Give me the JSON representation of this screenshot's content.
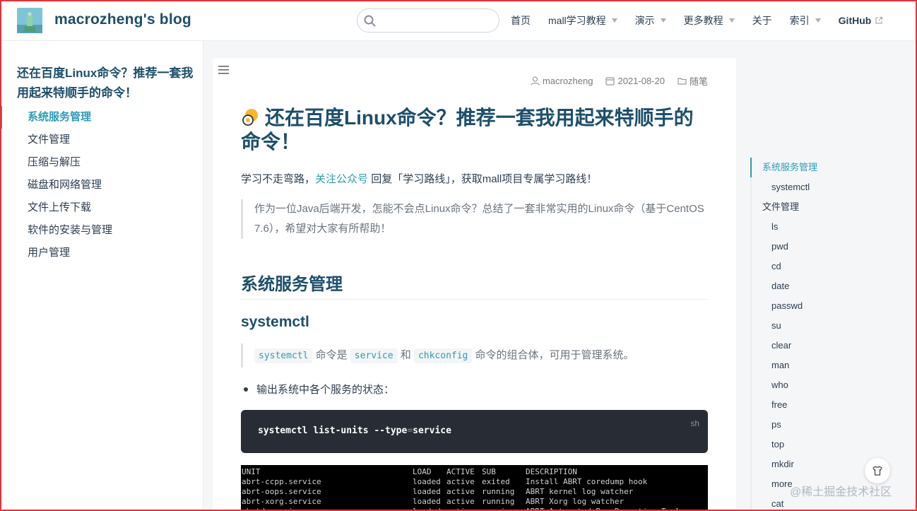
{
  "navbar": {
    "site_name": "macrozheng's blog",
    "search_placeholder": "",
    "links": [
      {
        "label": "首页",
        "dropdown": false
      },
      {
        "label": "mall学习教程",
        "dropdown": true
      },
      {
        "label": "演示",
        "dropdown": true
      },
      {
        "label": "更多教程",
        "dropdown": true
      },
      {
        "label": "关于",
        "dropdown": false
      },
      {
        "label": "索引",
        "dropdown": true
      },
      {
        "label": "GitHub",
        "dropdown": false,
        "external": true
      }
    ]
  },
  "sidebar": {
    "title": "还在百度Linux命令？推荐一套我用起来特顺手的命令！",
    "items": [
      "系统服务管理",
      "文件管理",
      "压缩与解压",
      "磁盘和网络管理",
      "文件上传下载",
      "软件的安装与管理",
      "用户管理"
    ],
    "active_index": 0
  },
  "article": {
    "meta": {
      "author": "macrozheng",
      "date": "2021-08-20",
      "category": "随笔"
    },
    "title": "还在百度Linux命令？推荐一套我用起来特顺手的命令！",
    "intro_prefix": "学习不走弯路，",
    "intro_link": "关注公众号",
    "intro_suffix": " 回复「学习路线」，获取mall项目专属学习路线！",
    "quote": "作为一位Java后端开发，怎能不会点Linux命令？总结了一套非常实用的Linux命令（基于CentOS 7.6），希望对大家有所帮助！",
    "h2": "系统服务管理",
    "h3": "systemctl",
    "quote2": {
      "code1": "systemctl",
      "text1": " 命令是 ",
      "code2": "service",
      "text2": " 和 ",
      "code3": "chkconfig",
      "text3": " 命令的组合体，可用于管理系统。"
    },
    "bullet": "输出系统中各个服务的状态：",
    "code": {
      "lang": "sh",
      "cmd": "systemctl list-units --type",
      "op": "=",
      "arg": "service"
    },
    "terminal": {
      "header": [
        "UNIT",
        "LOAD",
        "ACTIVE",
        "SUB",
        "DESCRIPTION"
      ],
      "rows": [
        [
          "abrt-ccpp.service",
          "loaded",
          "active",
          "exited",
          "Install ABRT coredump hook"
        ],
        [
          "abrt-oops.service",
          "loaded",
          "active",
          "running",
          "ABRT kernel log watcher"
        ],
        [
          "abrt-xorg.service",
          "loaded",
          "active",
          "running",
          "ABRT Xorg log watcher"
        ],
        [
          "abrtd.service",
          "loaded",
          "active",
          "running",
          "ABRT Automated Bug Reporting Tool"
        ]
      ]
    }
  },
  "toc": {
    "items": [
      {
        "label": "系统服务管理",
        "level": 1
      },
      {
        "label": "systemctl",
        "level": 2
      },
      {
        "label": "文件管理",
        "level": 1
      },
      {
        "label": "ls",
        "level": 2
      },
      {
        "label": "pwd",
        "level": 2
      },
      {
        "label": "cd",
        "level": 2
      },
      {
        "label": "date",
        "level": 2
      },
      {
        "label": "passwd",
        "level": 2
      },
      {
        "label": "su",
        "level": 2
      },
      {
        "label": "clear",
        "level": 2
      },
      {
        "label": "man",
        "level": 2
      },
      {
        "label": "who",
        "level": 2
      },
      {
        "label": "free",
        "level": 2
      },
      {
        "label": "ps",
        "level": 2
      },
      {
        "label": "top",
        "level": 2
      },
      {
        "label": "mkdir",
        "level": 2
      },
      {
        "label": "more",
        "level": 2
      },
      {
        "label": "cat",
        "level": 2
      }
    ],
    "active_index": 0
  },
  "watermark": "@稀土掘金技术社区",
  "colors": {
    "accent": "#2e9bb6",
    "heading": "#1d4f6b",
    "code_bg": "#282c34",
    "frame": "#e2333b"
  }
}
